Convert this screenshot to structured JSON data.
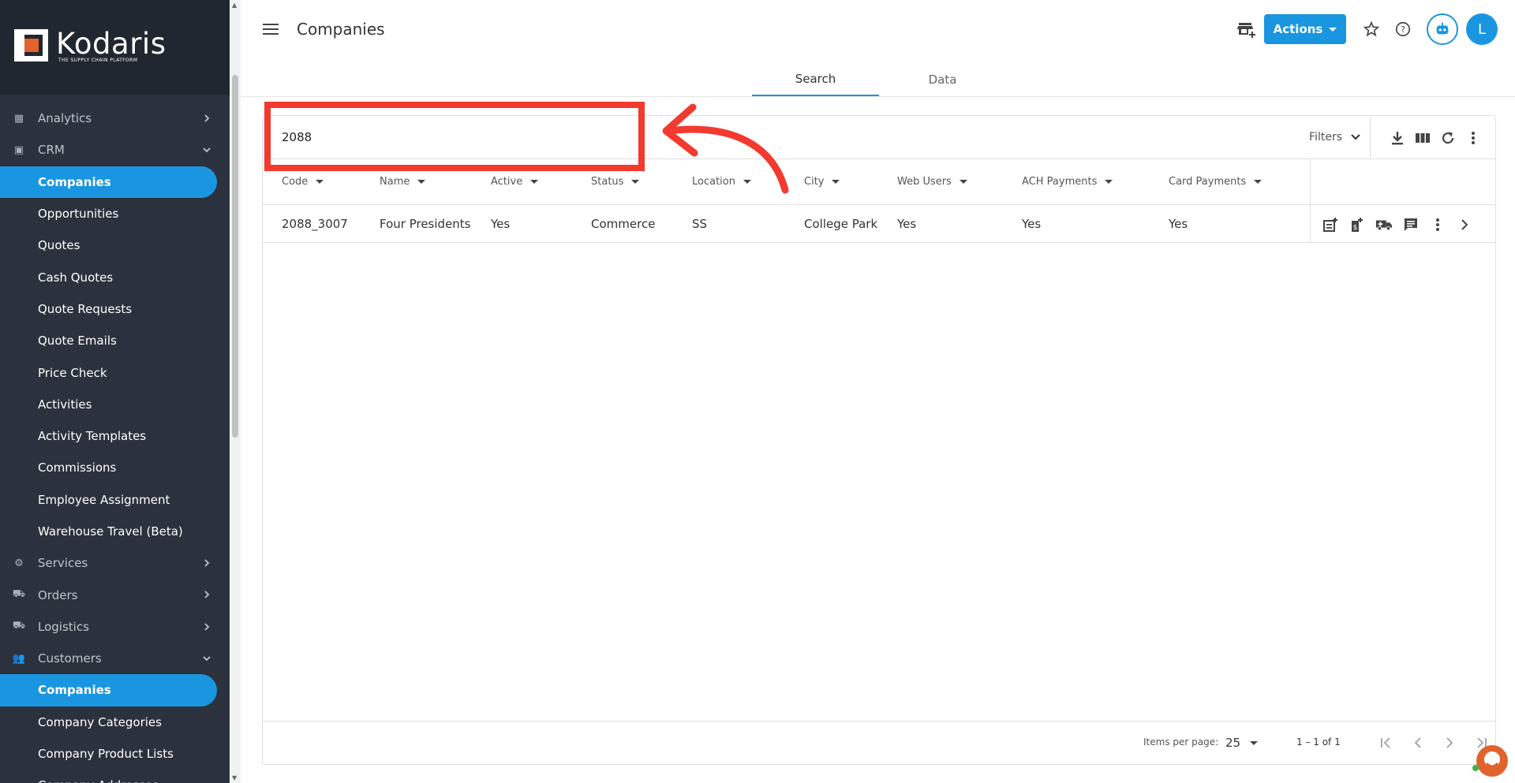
{
  "sidebar": {
    "brand": "Kodaris",
    "tagline": "THE SUPPLY CHAIN PLATFORM",
    "items": [
      {
        "label": "Analytics",
        "icon": "chart-icon",
        "type": "top",
        "chevron": "right"
      },
      {
        "label": "CRM",
        "icon": "contact-card-icon",
        "type": "top",
        "chevron": "down"
      },
      {
        "label": "Companies",
        "type": "sub",
        "active": true
      },
      {
        "label": "Opportunities",
        "type": "sub"
      },
      {
        "label": "Quotes",
        "type": "sub"
      },
      {
        "label": "Cash Quotes",
        "type": "sub"
      },
      {
        "label": "Quote Requests",
        "type": "sub"
      },
      {
        "label": "Quote Emails",
        "type": "sub"
      },
      {
        "label": "Price Check",
        "type": "sub"
      },
      {
        "label": "Activities",
        "type": "sub"
      },
      {
        "label": "Activity Templates",
        "type": "sub"
      },
      {
        "label": "Commissions",
        "type": "sub"
      },
      {
        "label": "Employee Assignment",
        "type": "sub"
      },
      {
        "label": "Warehouse Travel (Beta)",
        "type": "sub"
      },
      {
        "label": "Services",
        "icon": "gears-icon",
        "type": "top",
        "chevron": "right"
      },
      {
        "label": "Orders",
        "icon": "truck-icon",
        "type": "top",
        "chevron": "right"
      },
      {
        "label": "Logistics",
        "icon": "delivery-icon",
        "type": "top",
        "chevron": "right"
      },
      {
        "label": "Customers",
        "icon": "people-icon",
        "type": "top",
        "chevron": "down"
      },
      {
        "label": "Companies",
        "type": "sub",
        "active": true
      },
      {
        "label": "Company Categories",
        "type": "sub"
      },
      {
        "label": "Company Product Lists",
        "type": "sub"
      },
      {
        "label": "Company Addresses",
        "type": "sub"
      }
    ]
  },
  "header": {
    "title": "Companies",
    "actions_label": "Actions",
    "avatar_initial": "L"
  },
  "tabs": [
    {
      "label": "Search",
      "active": true
    },
    {
      "label": "Data",
      "active": false
    }
  ],
  "search": {
    "value": "2088",
    "filters_label": "Filters"
  },
  "table": {
    "columns": [
      "Code",
      "Name",
      "Active",
      "Status",
      "Location",
      "City",
      "Web Users",
      "ACH Payments",
      "Card Payments"
    ],
    "rows": [
      [
        "2088_3007",
        "Four Presidents",
        "Yes",
        "Commerce",
        "SS",
        "College Park",
        "Yes",
        "Yes",
        "Yes"
      ]
    ]
  },
  "pagination": {
    "items_per_page_label": "Items per page:",
    "items_per_page": "25",
    "range": "1 – 1 of 1"
  },
  "colors": {
    "accent": "#1a96e0",
    "sidebar_bg": "#2c323d",
    "annotation": "#f23a2f"
  }
}
